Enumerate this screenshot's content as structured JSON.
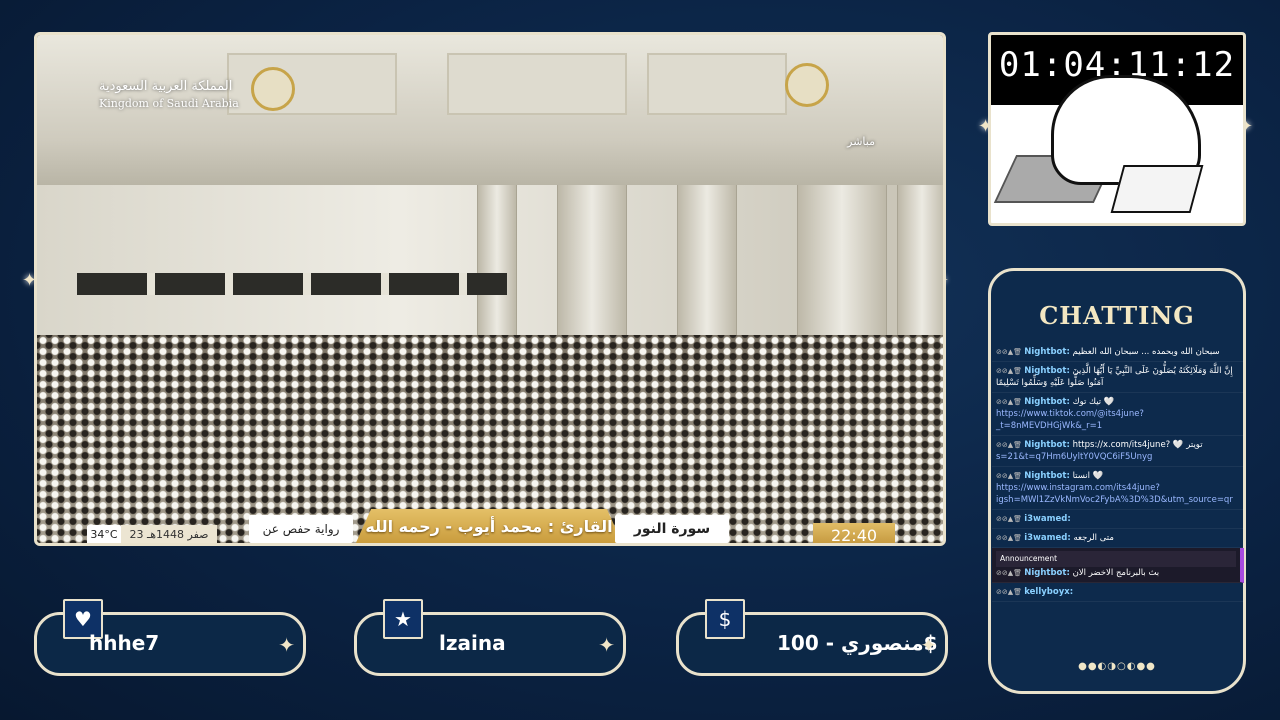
{
  "stream": {
    "watermark_ar": "المملكة العربية السعودية",
    "watermark_en": "Kingdom of Saudi Arabia",
    "live_label": "مباشر",
    "temperature": "34°C",
    "date": "23 صفر 1448هـ",
    "riwaya": "رواية حفص عن عاصم",
    "reciter": "القارئ : محمد أيوب - رحمه الله",
    "surah": "سورة النور",
    "clock": "22:40"
  },
  "timer": {
    "value": "01:04:11:12"
  },
  "chat": {
    "title": "CHATTING",
    "messages": [
      {
        "user": "Nightbot:",
        "text": "سبحان الله وبحمده ... سبحان الله العظيم"
      },
      {
        "user": "Nightbot:",
        "text": "إِنَّ اللَّهَ وَمَلَائِكَتَهُ يُصَلُّونَ عَلَى النَّبِيِّ يَا أَيُّهَا الَّذِينَ آمَنُوا صَلُّوا عَلَيْهِ وَسَلِّمُوا تَسْلِيمًا"
      },
      {
        "user": "Nightbot:",
        "text": "تيك توك 🤍",
        "link": "https://www.tiktok.com/@its4june?_t=8nMEVDHGjWk&_r=1"
      },
      {
        "user": "Nightbot:",
        "text": "https://x.com/its4june? 🤍 تويتر",
        "link": "s=21&t=q7Hm6UyltY0VQC6iF5Unyg"
      },
      {
        "user": "Nightbot:",
        "text": "انستا 🤍",
        "link": "https://www.instagram.com/its44june?igsh=MWl1ZzVkNmVoc2FybA%3D%3D&utm_source=qr"
      },
      {
        "user": "i3wamed:",
        "text": ""
      },
      {
        "user": "i3wamed:",
        "text": "متى الرجعه"
      }
    ],
    "announcement": {
      "label": "Announcement",
      "user": "Nightbot:",
      "text": "بث بالبرنامج الاخضر الان"
    },
    "last": {
      "user": "kellyboyx:",
      "text": ""
    }
  },
  "panels": {
    "heart": {
      "icon": "heart-icon",
      "name": "hhhe7"
    },
    "star": {
      "icon": "star-icon",
      "name": "lzaina"
    },
    "dollar": {
      "icon": "dollar-icon",
      "name": "منصوري - 100$"
    }
  }
}
